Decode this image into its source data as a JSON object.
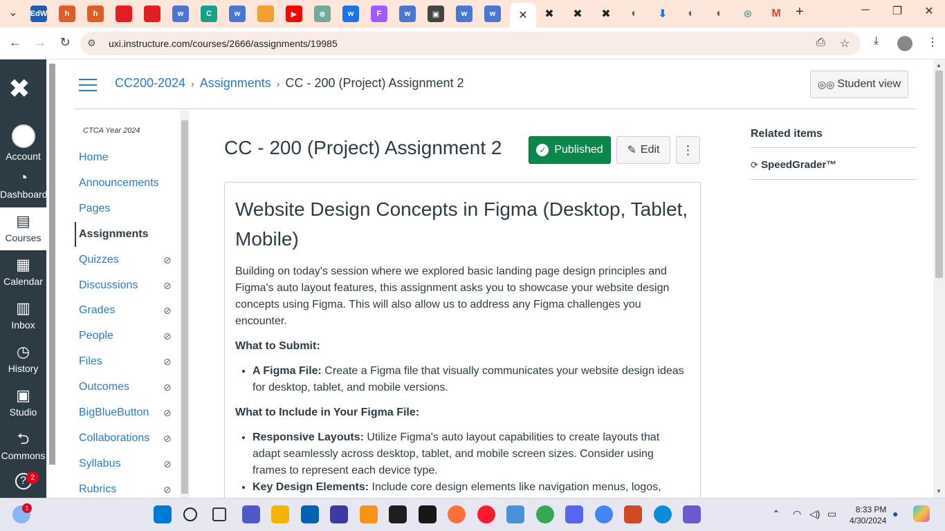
{
  "browser": {
    "active_tab_close": "✕",
    "url": "uxi.instructure.com/courses/2666/assignments/19985",
    "new_tab": "+",
    "tabs": [
      {
        "icon": "edweb-icon",
        "color": "#1a5fb4",
        "label": "EdW"
      },
      {
        "icon": "hangouts-icon",
        "color": "#e05d2a",
        "label": "h"
      },
      {
        "icon": "hangouts-icon",
        "color": "#e05d2a",
        "label": "h"
      },
      {
        "icon": "record-icon",
        "color": "#e51c23",
        "label": ""
      },
      {
        "icon": "record-icon",
        "color": "#e51c23",
        "label": ""
      },
      {
        "icon": "doc-icon",
        "color": "#4a78d0",
        "label": "w"
      },
      {
        "icon": "c-icon",
        "color": "#14a38a",
        "label": "C"
      },
      {
        "icon": "doc-icon",
        "color": "#4a78d0",
        "label": "w"
      },
      {
        "icon": "food-icon",
        "color": "#f0a030",
        "label": ""
      },
      {
        "icon": "youtube-icon",
        "color": "#ff0000",
        "label": "▶"
      },
      {
        "icon": "chatgpt-icon",
        "color": "#74aa9c",
        "label": "⊛"
      },
      {
        "icon": "doc-icon",
        "color": "#1a73e8",
        "label": "w"
      },
      {
        "icon": "figma-icon",
        "color": "#a259ff",
        "label": "F"
      },
      {
        "icon": "doc-icon",
        "color": "#4a78d0",
        "label": "w"
      },
      {
        "icon": "contact-icon",
        "color": "#444",
        "label": "▣"
      },
      {
        "icon": "doc-icon",
        "color": "#4a78d0",
        "label": "w"
      },
      {
        "icon": "doc-icon",
        "color": "#4a78d0",
        "label": "w"
      }
    ],
    "tabs_after": [
      {
        "icon": "x-icon",
        "color": "#222",
        "label": "✖"
      },
      {
        "icon": "x-icon",
        "color": "#222",
        "label": "✖"
      },
      {
        "icon": "x-icon",
        "color": "#222",
        "label": "✖"
      },
      {
        "icon": "globe-icon",
        "color": "#666",
        "label": "◐"
      },
      {
        "icon": "download-icon",
        "color": "#1a73e8",
        "label": "⬇"
      },
      {
        "icon": "globe-icon",
        "color": "#666",
        "label": "◐"
      },
      {
        "icon": "globe-icon",
        "color": "#666",
        "label": "◐"
      },
      {
        "icon": "chatgpt-icon",
        "color": "#74aa9c",
        "label": "⊛"
      },
      {
        "icon": "gmail-icon",
        "color": "#ea4335",
        "label": "M"
      }
    ]
  },
  "global_nav": {
    "items": [
      {
        "label": "Account",
        "icon": "account-icon"
      },
      {
        "label": "Dashboard",
        "icon": "dashboard-icon",
        "glyph": "◔"
      },
      {
        "label": "Courses",
        "icon": "courses-icon",
        "glyph": "▤"
      },
      {
        "label": "Calendar",
        "icon": "calendar-icon",
        "glyph": "▦"
      },
      {
        "label": "Inbox",
        "icon": "inbox-icon",
        "glyph": "▥"
      },
      {
        "label": "History",
        "icon": "history-icon",
        "glyph": "◷"
      },
      {
        "label": "Studio",
        "icon": "studio-icon",
        "glyph": "▣"
      },
      {
        "label": "Commons",
        "icon": "commons-icon",
        "glyph": "⮌"
      }
    ],
    "help_badge": "2",
    "help_glyph": "?"
  },
  "header": {
    "crumb_course": "CC200-2024",
    "crumb_section": "Assignments",
    "crumb_current": "CC - 200 (Project) Assignment 2",
    "student_view": "Student view"
  },
  "course_nav": {
    "term": "CTCA Year 2024",
    "items": [
      {
        "label": "Home",
        "hidden": false
      },
      {
        "label": "Announcements",
        "hidden": false
      },
      {
        "label": "Pages",
        "hidden": false
      },
      {
        "label": "Assignments",
        "hidden": false,
        "active": true
      },
      {
        "label": "Quizzes",
        "hidden": true
      },
      {
        "label": "Discussions",
        "hidden": true
      },
      {
        "label": "Grades",
        "hidden": true
      },
      {
        "label": "People",
        "hidden": true
      },
      {
        "label": "Files",
        "hidden": true
      },
      {
        "label": "Outcomes",
        "hidden": true
      },
      {
        "label": "BigBlueButton",
        "hidden": true
      },
      {
        "label": "Collaborations",
        "hidden": true
      },
      {
        "label": "Syllabus",
        "hidden": true
      },
      {
        "label": "Rubrics",
        "hidden": true
      }
    ]
  },
  "assignment": {
    "title": "CC - 200 (Project) Assignment 2",
    "published_label": "Published",
    "edit_label": "Edit",
    "heading": "Website Design Concepts in Figma (Desktop, Tablet, Mobile)",
    "intro": "Building on today's session where we explored basic landing page design principles and Figma's auto layout features, this assignment asks you to showcase your website design concepts using Figma. This will also allow us to address any Figma challenges you encounter.",
    "submit_heading": "What to Submit:",
    "submit_item_bold": "A Figma File:",
    "submit_item_text": " Create a Figma file that visually communicates your website design ideas for desktop, tablet, and mobile versions.",
    "include_heading": "What to Include in Your Figma File:",
    "include_items": [
      {
        "bold": "Responsive Layouts:",
        "text": " Utilize Figma's auto layout capabilities to create layouts that adapt seamlessly across desktop, tablet, and mobile screen sizes. Consider using frames to represent each device type."
      },
      {
        "bold": "Key Design Elements:",
        "text": " Include core design elements like navigation menus, logos, headers, content blocks, and call-to-action buttons. Remember, you don't need to go into high-"
      }
    ]
  },
  "sidebar": {
    "related_title": "Related items",
    "speedgrader": "SpeedGrader™"
  },
  "taskbar": {
    "weather_badge": "1",
    "time": "8:33 PM",
    "date": "4/30/2024"
  }
}
